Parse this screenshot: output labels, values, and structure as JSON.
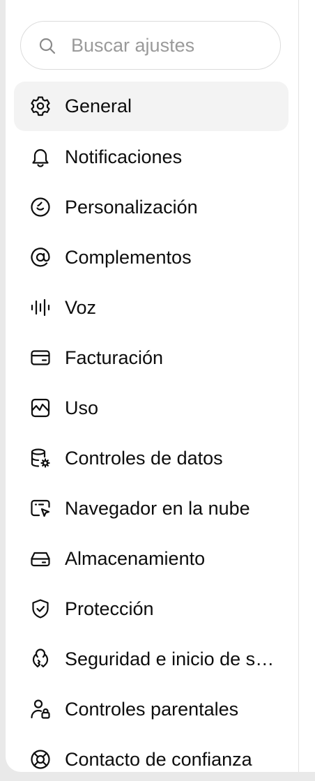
{
  "search": {
    "placeholder": "Buscar ajustes"
  },
  "menu": {
    "items": [
      {
        "label": "General",
        "icon": "gear-icon",
        "active": true
      },
      {
        "label": "Notificaciones",
        "icon": "bell-icon"
      },
      {
        "label": "Personalización",
        "icon": "personalization-icon"
      },
      {
        "label": "Complementos",
        "icon": "at-sign-icon"
      },
      {
        "label": "Voz",
        "icon": "voice-waveform-icon"
      },
      {
        "label": "Facturación",
        "icon": "credit-card-icon"
      },
      {
        "label": "Uso",
        "icon": "usage-chart-icon"
      },
      {
        "label": "Controles de datos",
        "icon": "database-gear-icon"
      },
      {
        "label": "Navegador en la nube",
        "icon": "browser-cursor-icon"
      },
      {
        "label": "Almacenamiento",
        "icon": "storage-drive-icon"
      },
      {
        "label": "Protección",
        "icon": "shield-check-icon"
      },
      {
        "label": "Seguridad e inicio de sesión",
        "icon": "security-icon"
      },
      {
        "label": "Controles parentales",
        "icon": "user-lock-icon"
      },
      {
        "label": "Contacto de confianza",
        "icon": "lifebuoy-icon"
      }
    ]
  },
  "colors": {
    "active_bg": "#f3f3f3",
    "text": "#0d0d0d",
    "placeholder": "#9a9a9a"
  }
}
